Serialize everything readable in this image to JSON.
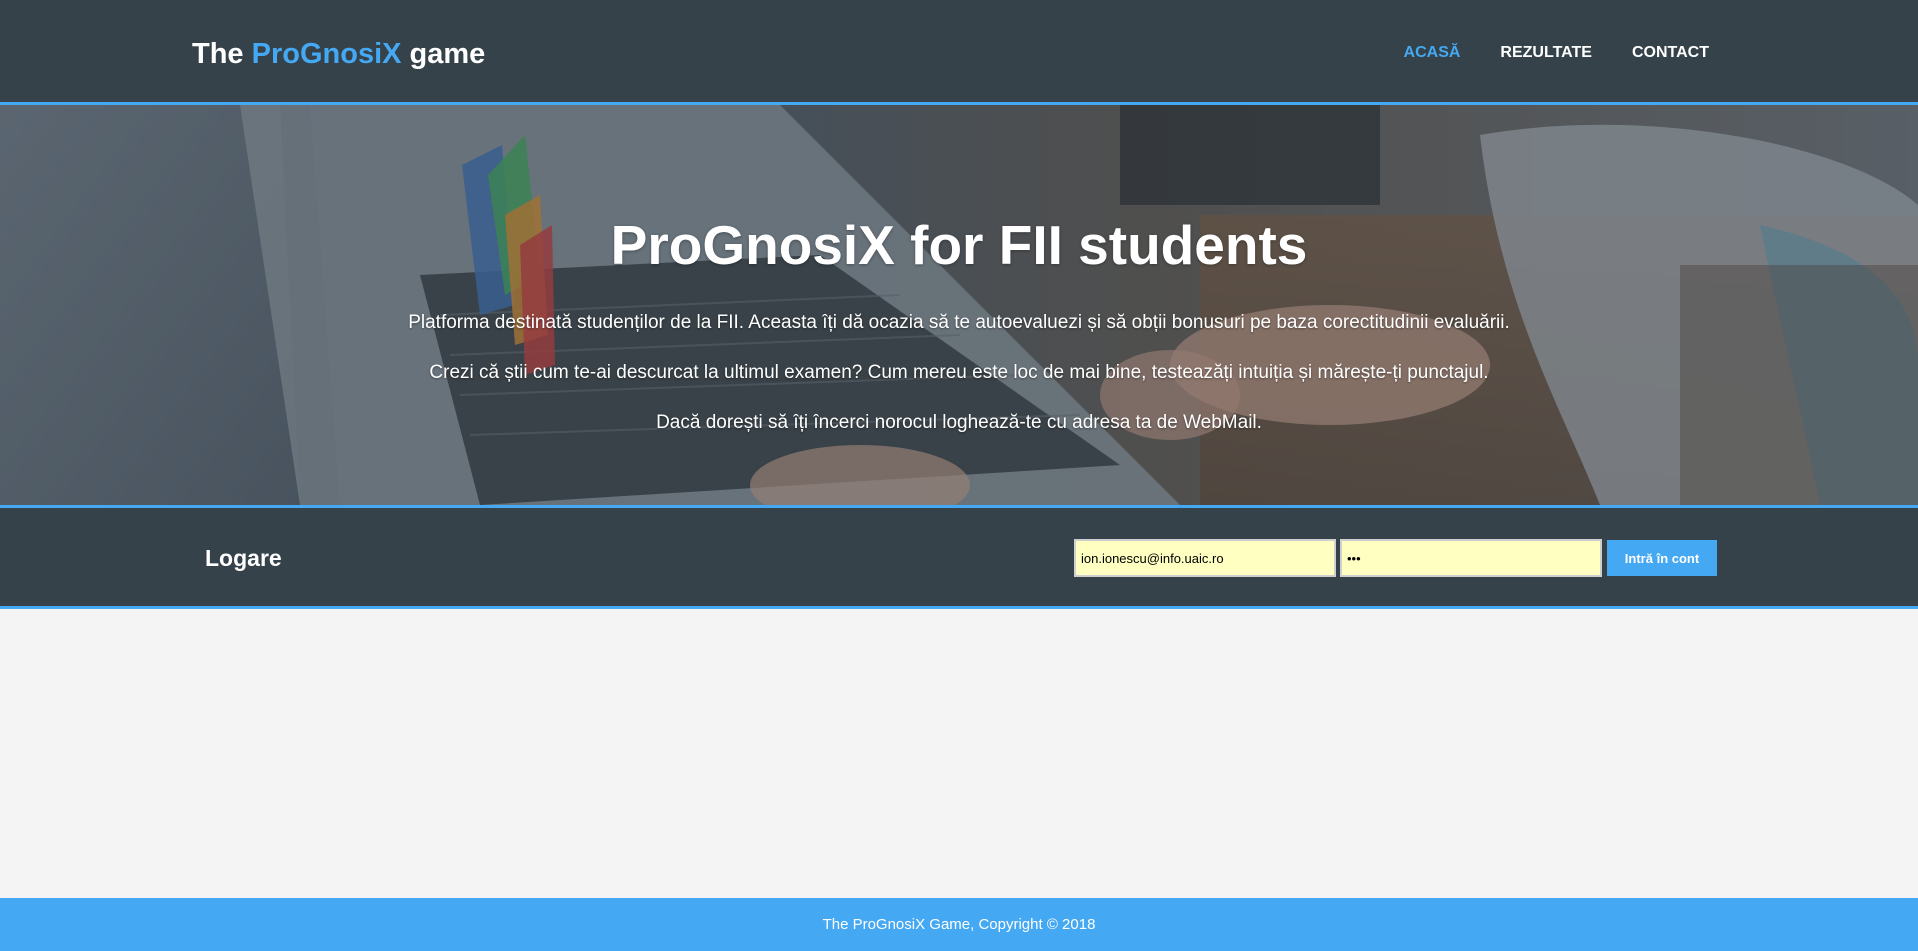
{
  "header": {
    "logo_prefix": "The ",
    "logo_highlight": "ProGnosiX",
    "logo_suffix": " game",
    "nav": [
      {
        "label": "ACASĂ",
        "active": true
      },
      {
        "label": "REZULTATE",
        "active": false
      },
      {
        "label": "CONTACT",
        "active": false
      }
    ]
  },
  "hero": {
    "title": "ProGnosiX for FII students",
    "paragraphs": [
      "Platforma destinată studenților de la FII. Aceasta îți dă ocazia să te autoevaluezi și să obții bonusuri pe baza corectitudinii evaluării.",
      "Crezi că știi cum te-ai descurcat la ultimul examen? Cum mereu este loc de mai bine, testează​ți intuiția și mărește-ți punctajul.",
      "Dacă dorești să îți încerci norocul loghează-te cu adresa ta de WebMail."
    ]
  },
  "login": {
    "title": "Logare",
    "email_value": "ion.ionescu@info.uaic.ro",
    "password_value": "•••",
    "submit_label": "Intră în cont"
  },
  "footer": {
    "text": "The ProGnosiX Game, Copyright © 2018"
  },
  "colors": {
    "accent": "#44a8f2",
    "dark": "#35424a",
    "background": "#f4f4f4",
    "input_autofill": "#ffffc2"
  }
}
